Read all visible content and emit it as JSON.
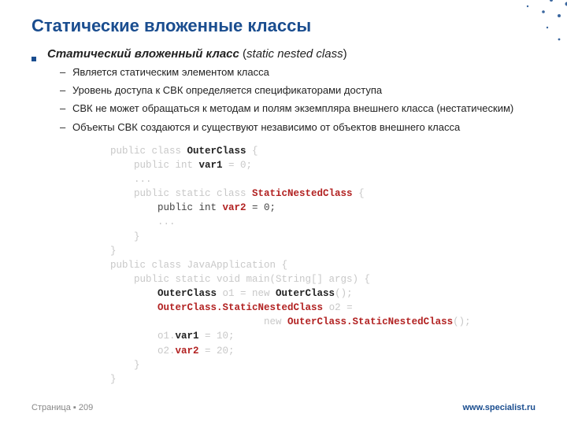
{
  "title": "Статические вложенные классы",
  "lead": {
    "bold": "Статический вложенный класс",
    "paren_open": " (",
    "italic": "static nested class",
    "paren_close": ")"
  },
  "bullets": [
    "Является статическим элементом класса",
    "Уровень доступа к СВК определяется спецификаторами доступа",
    "СВК не может обращаться к методам и полям экземпляра внешнего класса (нестатическим)",
    "Объекты СВК создаются и существуют независимо от объектов внешнего класса"
  ],
  "code": {
    "l1a": "public class ",
    "l1b": "OuterClass",
    "l1c": " {",
    "l2a": "    public int ",
    "l2b": "var1",
    "l2c": " = 0;",
    "l3": "    ...",
    "l4a": "    public static class ",
    "l4b": "StaticNestedClass",
    "l4c": " {",
    "l5a": "        public int ",
    "l5b": "var2",
    "l5c": " = 0;",
    "l6": "        ...",
    "l7": "    }",
    "l8": "}",
    "l9a": "public class ",
    "l9b": "JavaApplication",
    "l9c": " {",
    "l10": "    public static void main(String[] args) {",
    "l11a": "        ",
    "l11b": "OuterClass",
    "l11c": " o1 = new ",
    "l11d": "OuterClass",
    "l11e": "();",
    "l12a": "        ",
    "l12b": "OuterClass.StaticNestedClass",
    "l12c": " o2 =",
    "l13a": "                          new ",
    "l13b": "OuterClass.StaticNestedClass",
    "l13c": "();",
    "l14a": "        o1.",
    "l14b": "var1",
    "l14c": " = 10;",
    "l15a": "        o2.",
    "l15b": "var2",
    "l15c": " = 20;",
    "l16": "    }",
    "l17": "}"
  },
  "footer": {
    "page_label": "Страница ▪ ",
    "page_num": "209",
    "site": "www.specialist.ru"
  }
}
